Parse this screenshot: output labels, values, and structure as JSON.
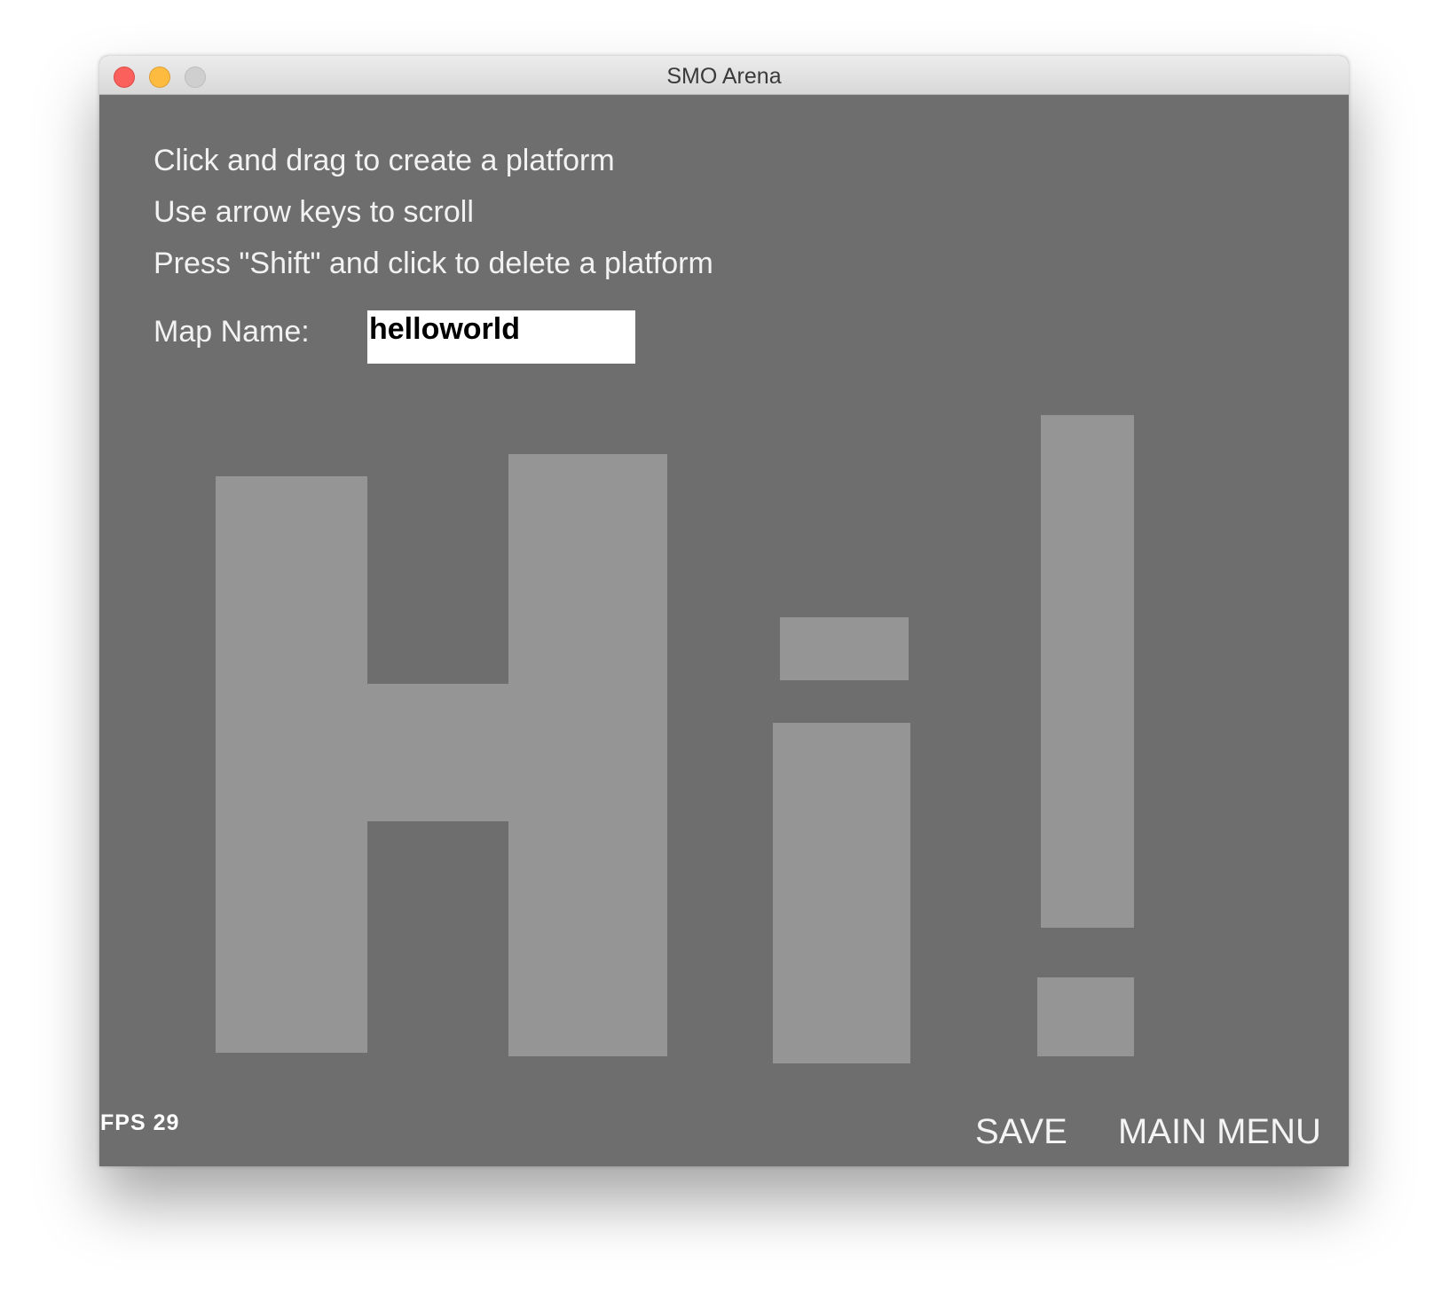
{
  "window": {
    "title": "SMO Arena"
  },
  "instructions": [
    "Click and drag to create a platform",
    "Use arrow keys to scroll",
    "Press \"Shift\" and click to delete a platform"
  ],
  "map_name": {
    "label": "Map Name:",
    "value": "helloworld"
  },
  "platforms": {
    "count": 9,
    "color": "#959595"
  },
  "fps": {
    "text": "FPS 29"
  },
  "buttons": {
    "save": "SAVE",
    "main_menu": "MAIN MENU"
  },
  "colors": {
    "background": "#6e6e6e",
    "platform": "#959595",
    "text": "#f2f2f2"
  }
}
